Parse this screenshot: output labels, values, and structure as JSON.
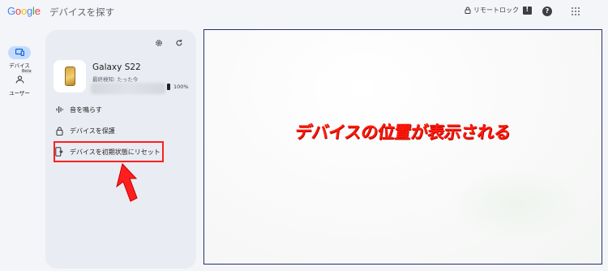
{
  "header": {
    "logo_parts": [
      "G",
      "o",
      "o",
      "g",
      "l",
      "e"
    ],
    "title": "デバイスを探す",
    "lock_label": "リモートロック"
  },
  "rail": {
    "items": [
      {
        "label": "デバイス",
        "active": true,
        "icon": "devices-icon"
      },
      {
        "label": "ユーザー",
        "active": false,
        "icon": "user-icon",
        "badge": "Beta"
      }
    ]
  },
  "device": {
    "name": "Galaxy S22",
    "last_seen": "最終検知: たった今",
    "battery": "100%"
  },
  "actions": [
    {
      "label": "音を鳴らす",
      "icon": "sound-icon"
    },
    {
      "label": "デバイスを保護",
      "icon": "lock-icon"
    },
    {
      "label": "デバイスを初期状態にリセット",
      "icon": "reset-icon"
    }
  ],
  "map": {
    "overlay_text": "デバイスの位置が表示される"
  },
  "colors": {
    "accent": "#c2dbff",
    "highlight": "#ff1f1f",
    "overlay_text": "#ff1a0a",
    "map_border": "#27306b"
  }
}
